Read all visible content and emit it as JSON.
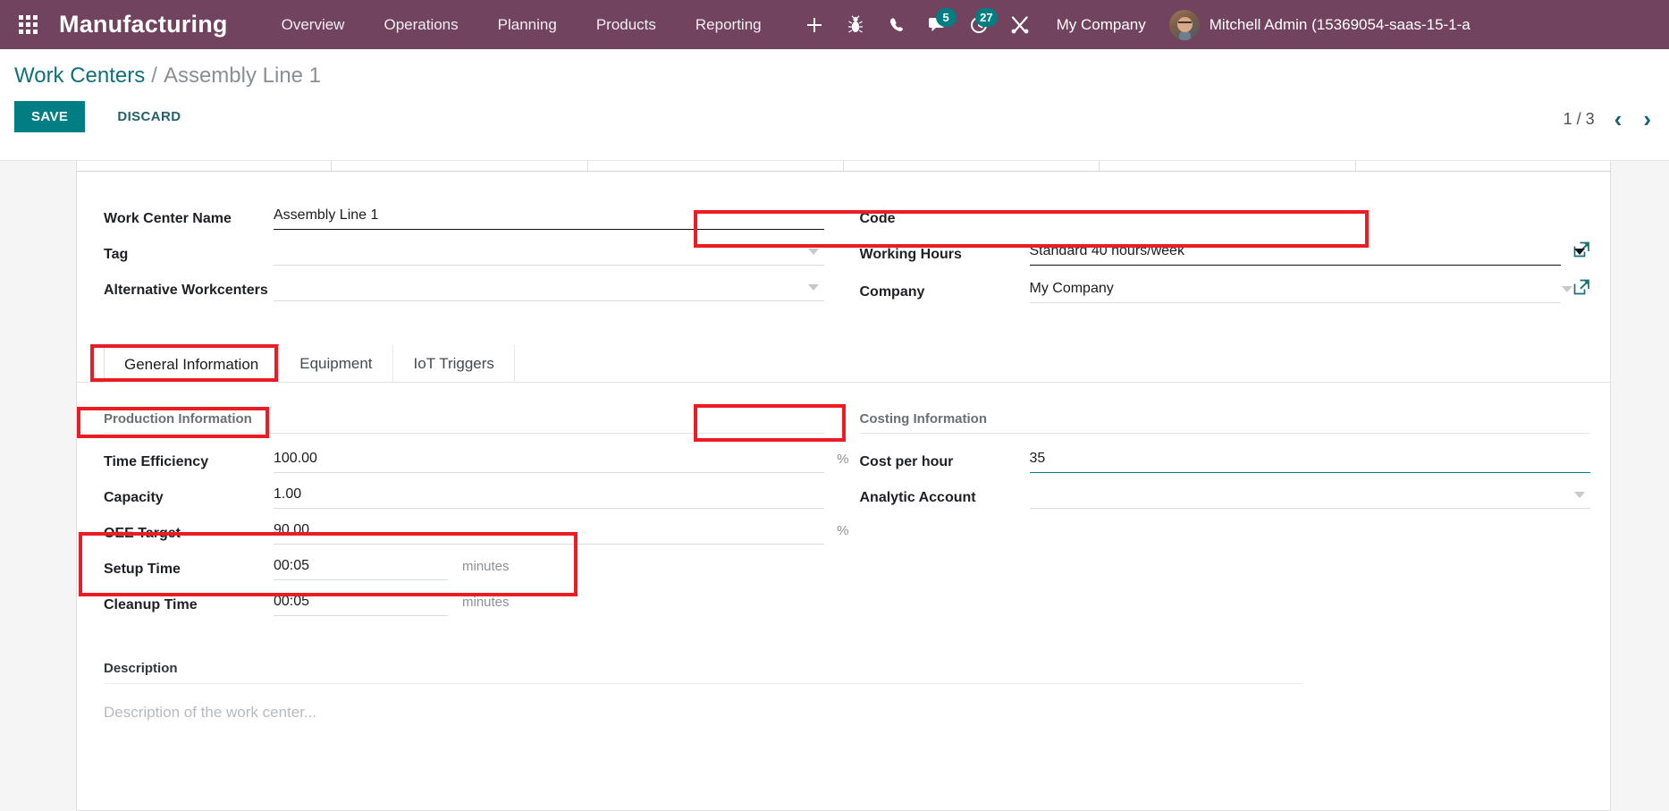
{
  "navbar": {
    "apps_icon": "apps-grid-icon",
    "brand": "Manufacturing",
    "menu": [
      {
        "label": "Overview"
      },
      {
        "label": "Operations"
      },
      {
        "label": "Planning"
      },
      {
        "label": "Products"
      },
      {
        "label": "Reporting"
      }
    ],
    "icons": [
      {
        "name": "plus-icon",
        "glyph": "+"
      },
      {
        "name": "bug-icon",
        "glyph": "bug"
      },
      {
        "name": "phone-icon",
        "glyph": "phone"
      },
      {
        "name": "chat-icon",
        "glyph": "chat",
        "badge": "5"
      },
      {
        "name": "activities-clock-icon",
        "glyph": "clock",
        "badge": "27"
      },
      {
        "name": "tools-icon",
        "glyph": "tools"
      }
    ],
    "company": "My Company",
    "user": "Mitchell Admin (15369054-saas-15-1-a",
    "accent_purple": "#71435f",
    "badge_color": "#017e84"
  },
  "control_panel": {
    "breadcrumb_root": "Work Centers",
    "breadcrumb_sep": "/",
    "breadcrumb_current": "Assembly Line 1",
    "save_label": "SAVE",
    "discard_label": "DISCARD",
    "pager_value": "1 / 3",
    "pager_prev": "‹",
    "pager_next": "›"
  },
  "form": {
    "left": [
      {
        "label": "Work Center Name",
        "value": "Assembly Line 1",
        "placeholder": "",
        "type": "text",
        "underline": "strong"
      },
      {
        "label": "Tag",
        "value": "",
        "placeholder": "",
        "type": "select",
        "underline": "light"
      },
      {
        "label": "Alternative Workcenters",
        "value": "",
        "placeholder": "",
        "type": "select",
        "underline": "light"
      }
    ],
    "right": [
      {
        "label": "Code",
        "value": "",
        "placeholder": "",
        "type": "text",
        "underline": "none"
      },
      {
        "label": "Working Hours",
        "value": "Standard 40 hours/week",
        "placeholder": "",
        "type": "select",
        "underline": "strong",
        "ext_link": true,
        "annotated": true
      },
      {
        "label": "Company",
        "value": "My Company",
        "placeholder": "",
        "type": "select",
        "underline": "light",
        "ext_link": true
      }
    ]
  },
  "tabs": [
    {
      "label": "General Information",
      "active": true,
      "annotated": true
    },
    {
      "label": "Equipment",
      "active": false
    },
    {
      "label": "IoT Triggers",
      "active": false
    }
  ],
  "production": {
    "section_title": "Production Information",
    "rows": [
      {
        "label": "Time Efficiency",
        "value": "100.00",
        "suffix": "%"
      },
      {
        "label": "Capacity",
        "value": "1.00",
        "suffix": ""
      },
      {
        "label": "OEE Target",
        "value": "90.00",
        "suffix": "%"
      },
      {
        "label": "Setup Time",
        "value": "00:05",
        "suffix": "minutes"
      },
      {
        "label": "Cleanup Time",
        "value": "00:05",
        "suffix": "minutes"
      }
    ]
  },
  "costing": {
    "section_title": "Costing Information",
    "rows": [
      {
        "label": "Cost per hour",
        "value": "35",
        "underline": "teal"
      },
      {
        "label": "Analytic Account",
        "value": "",
        "underline": "light",
        "type": "select"
      }
    ]
  },
  "description": {
    "label": "Description",
    "placeholder": "Description of the work center..."
  },
  "annotation_color": "#ec1c24"
}
